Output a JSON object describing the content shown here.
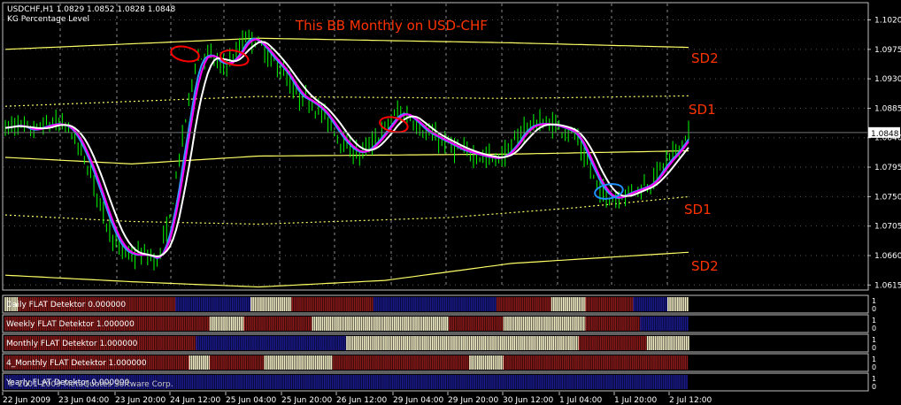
{
  "header": {
    "symbol_line": "USDCHF,H1  1.0829 1.0852 1.0828 1.0848",
    "indicator_line": "KG Percentage Level"
  },
  "annotation": {
    "title": "This BB Monthly on USD-CHF",
    "band_labels": [
      "SD2",
      "SD1",
      "SD1",
      "SD2"
    ]
  },
  "colors": {
    "background": "#000000",
    "candles": "#00ff00",
    "band_line": "#ffff66",
    "ma_white": "#ffffff",
    "ma_magenta": "#ff00ff",
    "ma_blue": "#3399ff",
    "annotation_text": "#ff3300",
    "circle_red": "#ff0000",
    "circle_blue": "#1e90ff",
    "panel_border": "#c0c0c0",
    "flat_red": "#8b1a1a",
    "flat_blue": "#1a1a8c",
    "flat_cream": "#f5f0c8"
  },
  "chart_data": {
    "type": "line",
    "title": "This BB Monthly on USD-CHF",
    "series_name": "USDCHF,H1",
    "ylim": [
      1.061,
      1.1045
    ],
    "y_ticks": [
      "1.1020",
      "1.0975",
      "1.0930",
      "1.0885",
      "1.0840",
      "1.0795",
      "1.0750",
      "1.0705",
      "1.0660",
      "1.0615"
    ],
    "y_tick_values": [
      1.102,
      1.0975,
      1.093,
      1.0885,
      1.084,
      1.0795,
      1.075,
      1.0705,
      1.066,
      1.0615
    ],
    "current_price": "1.0848",
    "current_price_value": 1.0848,
    "x_ticks": [
      "22 Jun 2009",
      "23 Jun 04:00",
      "23 Jun 20:00",
      "24 Jun 12:00",
      "25 Jun 04:00",
      "25 Jun 20:00",
      "26 Jun 12:00",
      "29 Jun 04:00",
      "29 Jun 20:00",
      "30 Jun 12:00",
      "1 Jul 04:00",
      "1 Jul 20:00",
      "2 Jul 12:00"
    ],
    "price_path": [
      [
        0,
        1.0855
      ],
      [
        1,
        1.086
      ],
      [
        2,
        1.085
      ],
      [
        3,
        1.0858
      ],
      [
        4,
        1.0862
      ],
      [
        5,
        1.0855
      ],
      [
        6,
        1.082
      ],
      [
        7,
        1.077
      ],
      [
        8,
        1.071
      ],
      [
        9,
        1.067
      ],
      [
        10,
        1.066
      ],
      [
        11,
        1.0662
      ],
      [
        12,
        1.0652
      ],
      [
        13,
        1.0715
      ],
      [
        14,
        1.084
      ],
      [
        15,
        1.0955
      ],
      [
        16,
        1.097
      ],
      [
        17,
        1.095
      ],
      [
        18,
        1.096
      ],
      [
        19,
        1.0995
      ],
      [
        20,
        1.0985
      ],
      [
        21,
        1.096
      ],
      [
        22,
        1.094
      ],
      [
        23,
        1.0905
      ],
      [
        24,
        1.0895
      ],
      [
        25,
        1.088
      ],
      [
        26,
        1.085
      ],
      [
        27,
        1.0825
      ],
      [
        28,
        1.0815
      ],
      [
        29,
        1.083
      ],
      [
        30,
        1.0855
      ],
      [
        31,
        1.088
      ],
      [
        32,
        1.087
      ],
      [
        33,
        1.085
      ],
      [
        34,
        1.084
      ],
      [
        35,
        1.083
      ],
      [
        36,
        1.082
      ],
      [
        37,
        1.0815
      ],
      [
        38,
        1.081
      ],
      [
        39,
        1.0808
      ],
      [
        40,
        1.0825
      ],
      [
        41,
        1.0855
      ],
      [
        42,
        1.0862
      ],
      [
        43,
        1.086
      ],
      [
        44,
        1.0855
      ],
      [
        45,
        1.0845
      ],
      [
        46,
        1.08
      ],
      [
        47,
        1.076
      ],
      [
        48,
        1.0745
      ],
      [
        49,
        1.0755
      ],
      [
        50,
        1.0762
      ],
      [
        51,
        1.077
      ],
      [
        52,
        1.08
      ],
      [
        53,
        1.082
      ],
      [
        54,
        1.0848
      ]
    ],
    "bands": {
      "upper_sd2": [
        [
          0,
          1.0975
        ],
        [
          20,
          1.0992
        ],
        [
          40,
          1.0985
        ],
        [
          54,
          1.0978
        ]
      ],
      "upper_sd1": [
        [
          0,
          1.0888
        ],
        [
          20,
          1.0903
        ],
        [
          40,
          1.09
        ],
        [
          54,
          1.0904
        ]
      ],
      "middle": [
        [
          0,
          1.081
        ],
        [
          10,
          1.08
        ],
        [
          20,
          1.0812
        ],
        [
          40,
          1.0815
        ],
        [
          54,
          1.082
        ]
      ],
      "lower_sd1": [
        [
          0,
          1.0722
        ],
        [
          10,
          1.0712
        ],
        [
          20,
          1.0708
        ],
        [
          35,
          1.0718
        ],
        [
          45,
          1.0733
        ],
        [
          54,
          1.075
        ]
      ],
      "lower_sd2": [
        [
          0,
          1.063
        ],
        [
          10,
          1.062
        ],
        [
          20,
          1.0612
        ],
        [
          30,
          1.0622
        ],
        [
          40,
          1.0648
        ],
        [
          54,
          1.0665
        ]
      ]
    },
    "highlights": [
      {
        "color": "red",
        "x": 14.2,
        "y": 1.0968
      },
      {
        "color": "red",
        "x": 18.1,
        "y": 1.0962
      },
      {
        "color": "red",
        "x": 30.7,
        "y": 1.086
      },
      {
        "color": "blue",
        "x": 47.7,
        "y": 1.0758
      }
    ]
  },
  "indicator_panels": [
    {
      "label": "Daily FLAT Detektor 0.000000",
      "side": "1\n0",
      "pattern": [
        [
          "c",
          0.02
        ],
        [
          "r",
          0.23
        ],
        [
          "b",
          0.11
        ],
        [
          "c",
          0.06
        ],
        [
          "r",
          0.12
        ],
        [
          "b",
          0.18
        ],
        [
          "r",
          0.08
        ],
        [
          "c",
          0.05
        ],
        [
          "r",
          0.07
        ],
        [
          "b",
          0.05
        ],
        [
          "c",
          0.03
        ]
      ]
    },
    {
      "label": "Weekly FLAT Detektor 1.000000",
      "side": "1\n0",
      "pattern": [
        [
          "r",
          0.3
        ],
        [
          "c",
          0.05
        ],
        [
          "r",
          0.1
        ],
        [
          "c",
          0.2
        ],
        [
          "r",
          0.08
        ],
        [
          "c",
          0.12
        ],
        [
          "r",
          0.08
        ],
        [
          "b",
          0.07
        ]
      ]
    },
    {
      "label": "Monthly FLAT Detektor 1.000000",
      "side": "1\n0",
      "pattern": [
        [
          "r",
          0.28
        ],
        [
          "b",
          0.22
        ],
        [
          "c",
          0.34
        ],
        [
          "r",
          0.1
        ],
        [
          "c",
          0.06
        ]
      ]
    },
    {
      "label": "4_Monthly FLAT Detektor 1.000000",
      "side": "1\n0",
      "pattern": [
        [
          "r",
          0.27
        ],
        [
          "c",
          0.03
        ],
        [
          "r",
          0.08
        ],
        [
          "c",
          0.1
        ],
        [
          "r",
          0.2
        ],
        [
          "c",
          0.05
        ],
        [
          "r",
          0.27
        ]
      ]
    },
    {
      "label": "Yearly FLAT Detektor 0.000000",
      "side": "1\n0",
      "pattern": [
        [
          "b",
          1.0
        ]
      ]
    }
  ],
  "copyright": "© 2001-2009 MetaQuotes Software Corp."
}
